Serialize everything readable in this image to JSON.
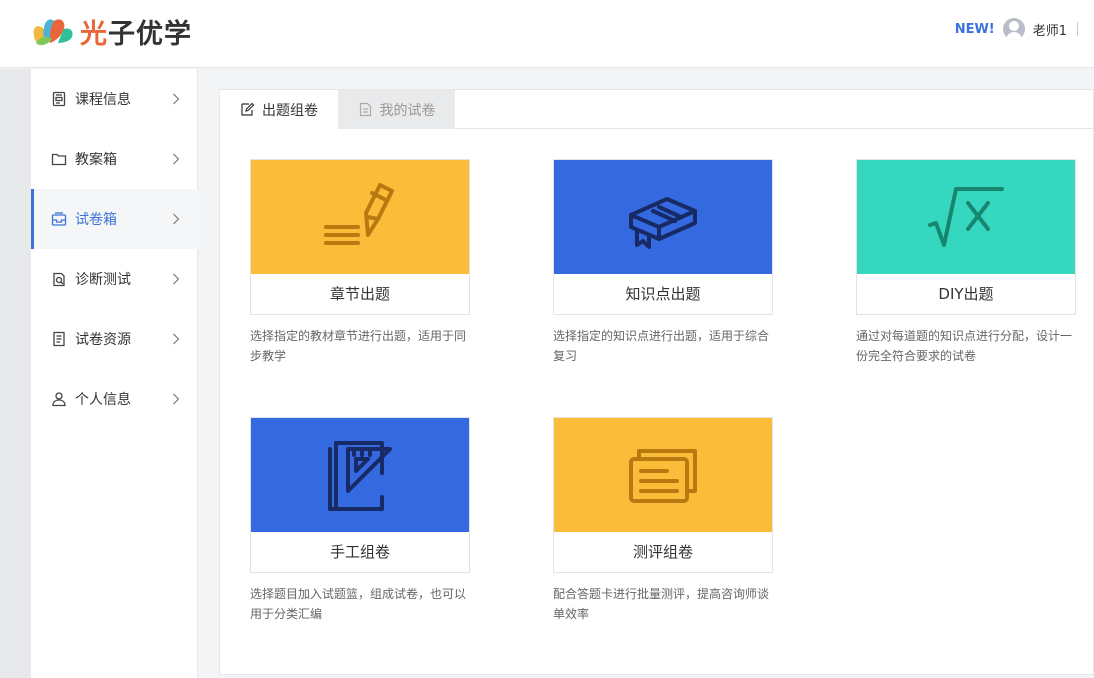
{
  "header": {
    "logo_text_accent": "光",
    "logo_text_rest": "子优学",
    "new_label": "NEW!",
    "user_name": "老师1"
  },
  "sidebar": {
    "items": [
      {
        "label": "课程信息",
        "icon": "course-icon"
      },
      {
        "label": "教案箱",
        "icon": "folder-icon"
      },
      {
        "label": "试卷箱",
        "icon": "inbox-icon",
        "active": true
      },
      {
        "label": "诊断测试",
        "icon": "diagnose-icon"
      },
      {
        "label": "试卷资源",
        "icon": "document-icon"
      },
      {
        "label": "个人信息",
        "icon": "user-icon"
      }
    ]
  },
  "tabs": [
    {
      "label": "出题组卷",
      "icon": "edit-icon",
      "active": true
    },
    {
      "label": "我的试卷",
      "icon": "document-icon",
      "active": false
    }
  ],
  "cards": [
    {
      "title": "章节出题",
      "desc": "选择指定的教材章节进行出题，适用于同步教学",
      "color": "#fbbc3a",
      "icon": "pencil-lines-icon"
    },
    {
      "title": "知识点出题",
      "desc": "选择指定的知识点进行出题，适用于综合复习",
      "color": "#3469df",
      "icon": "book-stack-icon"
    },
    {
      "title": "DIY出题",
      "desc": "通过对每道题的知识点进行分配，设计一份完全符合要求的试卷",
      "color": "#35d8bf",
      "icon": "sqrt-x-icon"
    },
    {
      "title": "手工组卷",
      "desc": "选择题目加入试题篮，组成试卷，也可以用于分类汇编",
      "color": "#3469df",
      "icon": "notebook-ruler-icon"
    },
    {
      "title": "测评组卷",
      "desc": "配合答题卡进行批量测评，提高咨询师谈单效率",
      "color": "#fbbc3a",
      "icon": "paper-stack-icon"
    }
  ],
  "colors": {
    "accent": "#3b73d8",
    "yellow": "#fbbc3a",
    "blue": "#3469df",
    "teal": "#35d8bf"
  }
}
